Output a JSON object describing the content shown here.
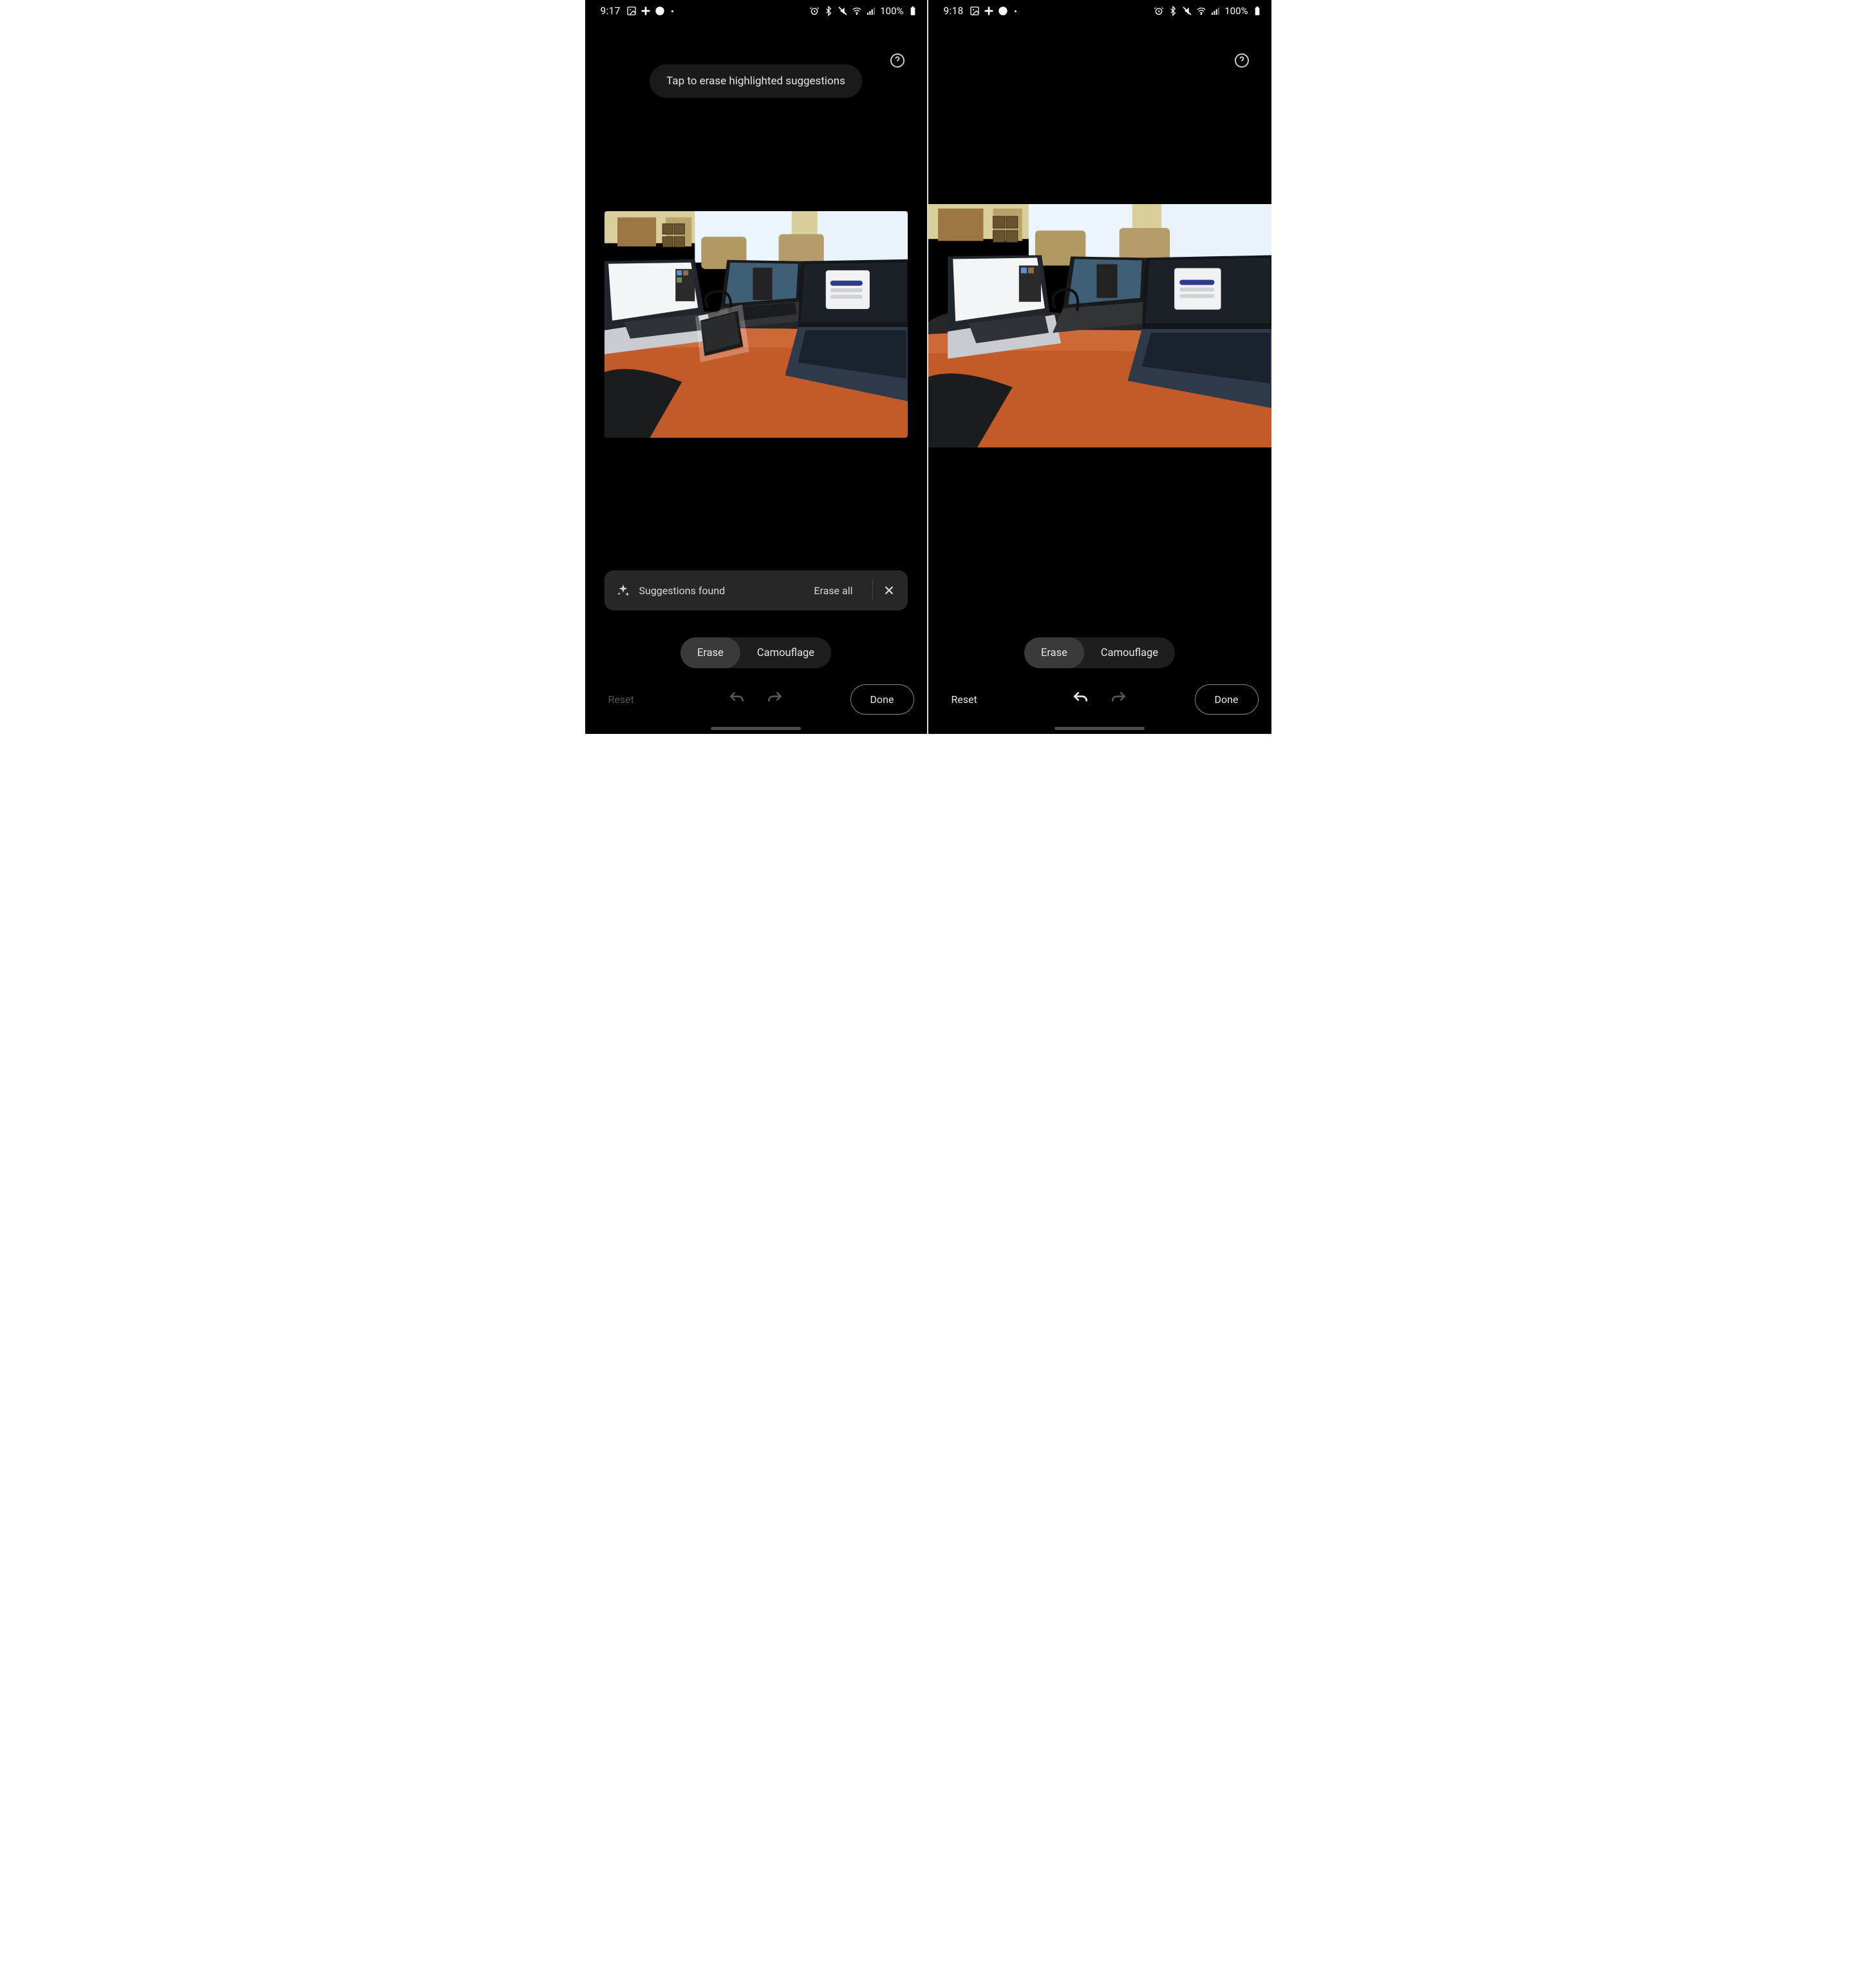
{
  "screens": {
    "left": {
      "status": {
        "time": "9:17",
        "battery": "100%"
      },
      "tooltip": "Tap to erase highlighted suggestions",
      "banner": {
        "text": "Suggestions found",
        "erase_all": "Erase all"
      },
      "segments": {
        "erase": "Erase",
        "camouflage": "Camouflage"
      },
      "bottom": {
        "reset": "Reset",
        "done": "Done"
      },
      "reset_disabled": true,
      "undo_enabled": false,
      "redo_enabled": false,
      "has_banner": true,
      "has_tooltip": true
    },
    "right": {
      "status": {
        "time": "9:18",
        "battery": "100%"
      },
      "segments": {
        "erase": "Erase",
        "camouflage": "Camouflage"
      },
      "bottom": {
        "reset": "Reset",
        "done": "Done"
      },
      "reset_disabled": false,
      "undo_enabled": true,
      "redo_enabled": false,
      "has_banner": false,
      "has_tooltip": false
    }
  },
  "icons": {
    "gallery": "gallery-icon",
    "slack": "slack-icon",
    "wear": "wear-icon",
    "alarm": "alarm-icon",
    "bluetooth": "bluetooth-icon",
    "vibrate": "vibrate-icon",
    "wifi": "wifi-icon",
    "signal": "signal-icon",
    "battery_full": "battery-full-icon"
  }
}
